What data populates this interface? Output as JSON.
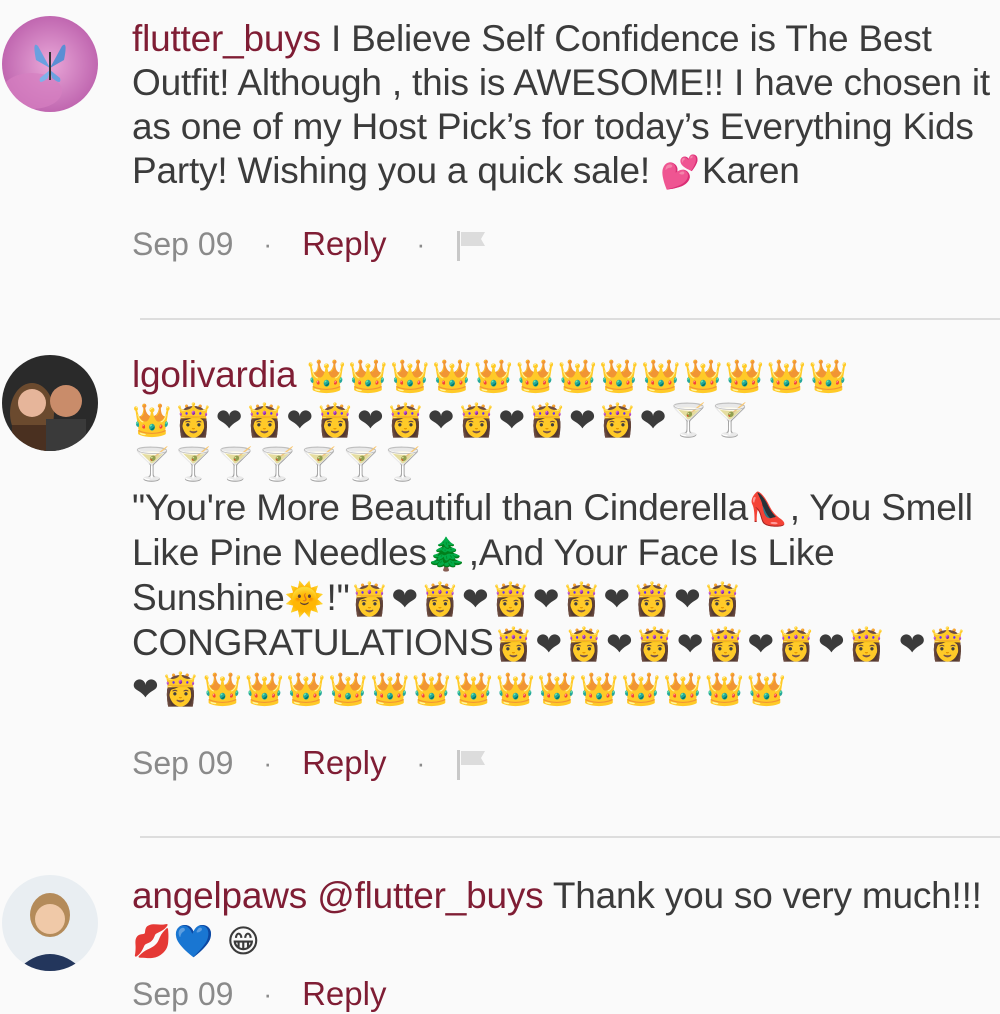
{
  "comments": [
    {
      "username": "flutter_buys",
      "text_part1": "I Believe Self Confidence is The Best Outfit! Although , this is AWESOME!! I have chosen it as one of my Host Pick’s for today’s Everything Kids Party! Wishing you a quick sale! ",
      "emoji1": "💕",
      "text_part2": "Karen",
      "date": "Sep 09",
      "reply_label": "Reply"
    },
    {
      "username": "lgolivardia",
      "line_a": "👑👑👑👑👑👑👑👑👑👑👑👑👑",
      "line_b": "👑👸❤👸❤👸❤👸❤👸❤👸❤👸❤🍸🍸",
      "line_c": "🍸🍸🍸🍸🍸🍸🍸",
      "quote1": "\"You're More Beautiful than Cinderella",
      "shoe": "👠",
      "quote2": ", You Smell Like Pine Needles",
      "tree": "🌲",
      "quote3": ",And Your Face Is Like Sunshine",
      "sun": "🌞",
      "quote4": "!\"",
      "hearts1": "👸❤👸❤👸❤👸❤👸❤👸",
      "congrats": "CONGRATULATIONS",
      "hearts2": "👸❤👸❤👸❤👸❤👸❤👸",
      "hearts3": "❤👸❤👸👑👑👑👑👑👑👑👑👑👑👑👑👑👑",
      "date": "Sep 09",
      "reply_label": "Reply"
    },
    {
      "username": "angelpaws",
      "mention": "@flutter_buys",
      "text": " Thank you so very much!!! ",
      "emojis": "💋💙 😁",
      "date": "Sep 09",
      "reply_label": "Reply"
    }
  ],
  "icons": {
    "flag": "flag-icon",
    "separator": "·"
  },
  "colors": {
    "username": "#7f1d34",
    "reply": "#7f1d34",
    "date": "#8a8a8a",
    "text": "#3b3b3b",
    "background": "#fafafa",
    "divider": "#dddddd"
  }
}
